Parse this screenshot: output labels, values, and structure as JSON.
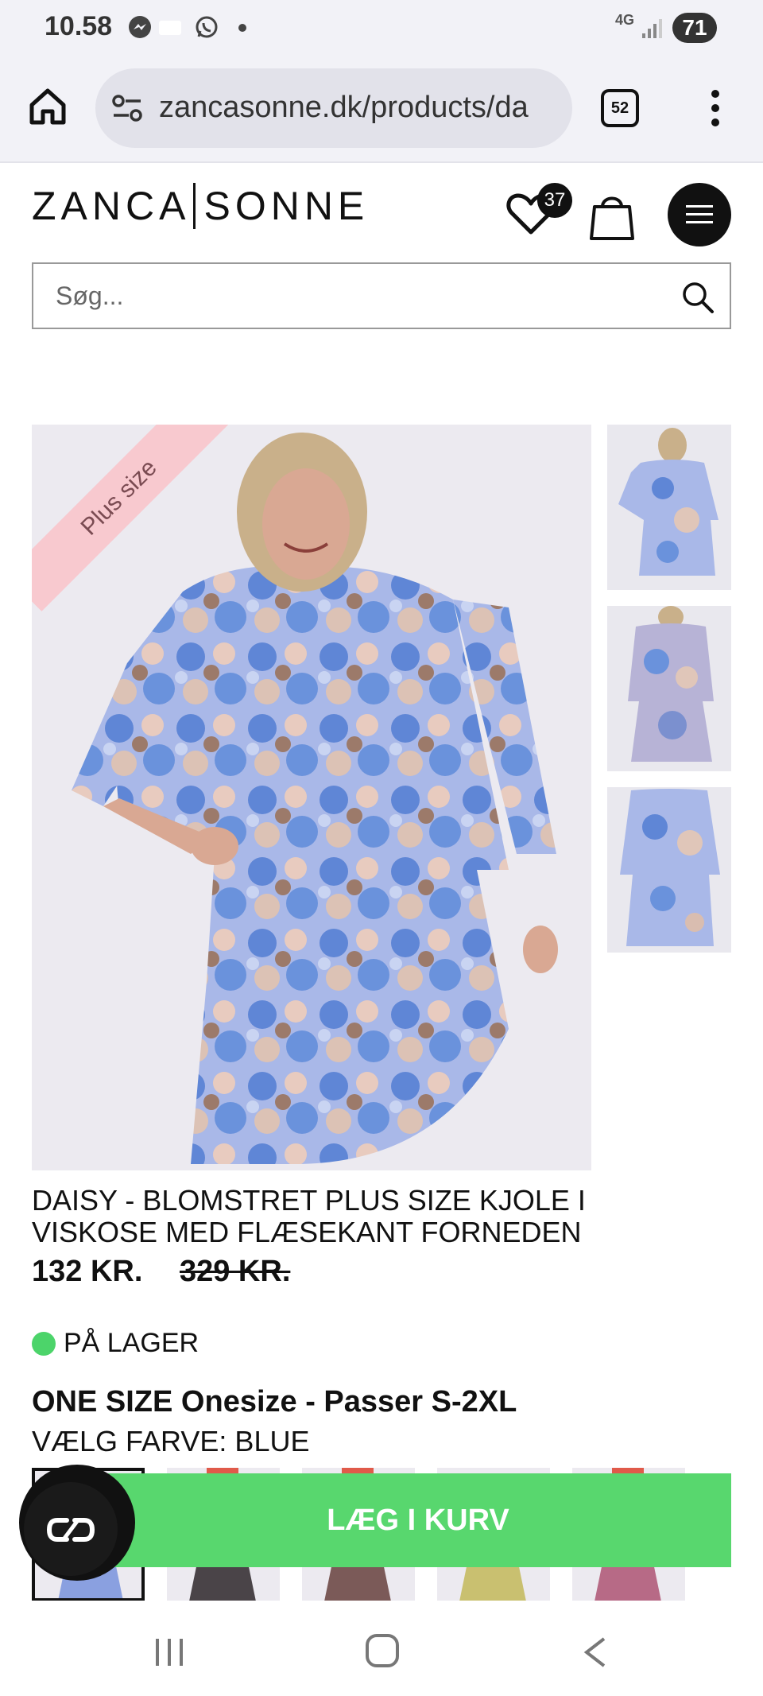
{
  "status_bar": {
    "time": "10.58",
    "network": "4G",
    "battery": "71"
  },
  "browser": {
    "url": "zancasonne.dk/products/da",
    "tab_count": "52"
  },
  "site": {
    "logo_left": "ZANCA",
    "logo_right": "SONNE",
    "wishlist_count": "37",
    "search_placeholder": "Søg..."
  },
  "product": {
    "badge": "Plus size",
    "title": "DAISY - BLOMSTRET PLUS SIZE KJOLE I VISKOSE MED FLÆSEKANT FORNEDEN",
    "price": "132 KR.",
    "old_price": "329 KR.",
    "stock": "PÅ LAGER",
    "size": "ONE SIZE Onesize - Passer S-2XL",
    "color": "VÆLG FARVE: BLUE",
    "add_to_cart": "LÆG I KURV"
  },
  "colors": {
    "accent_green": "#58d76e",
    "ribbon_pink": "#f8c9cf",
    "stock_green": "#4cd46a"
  }
}
